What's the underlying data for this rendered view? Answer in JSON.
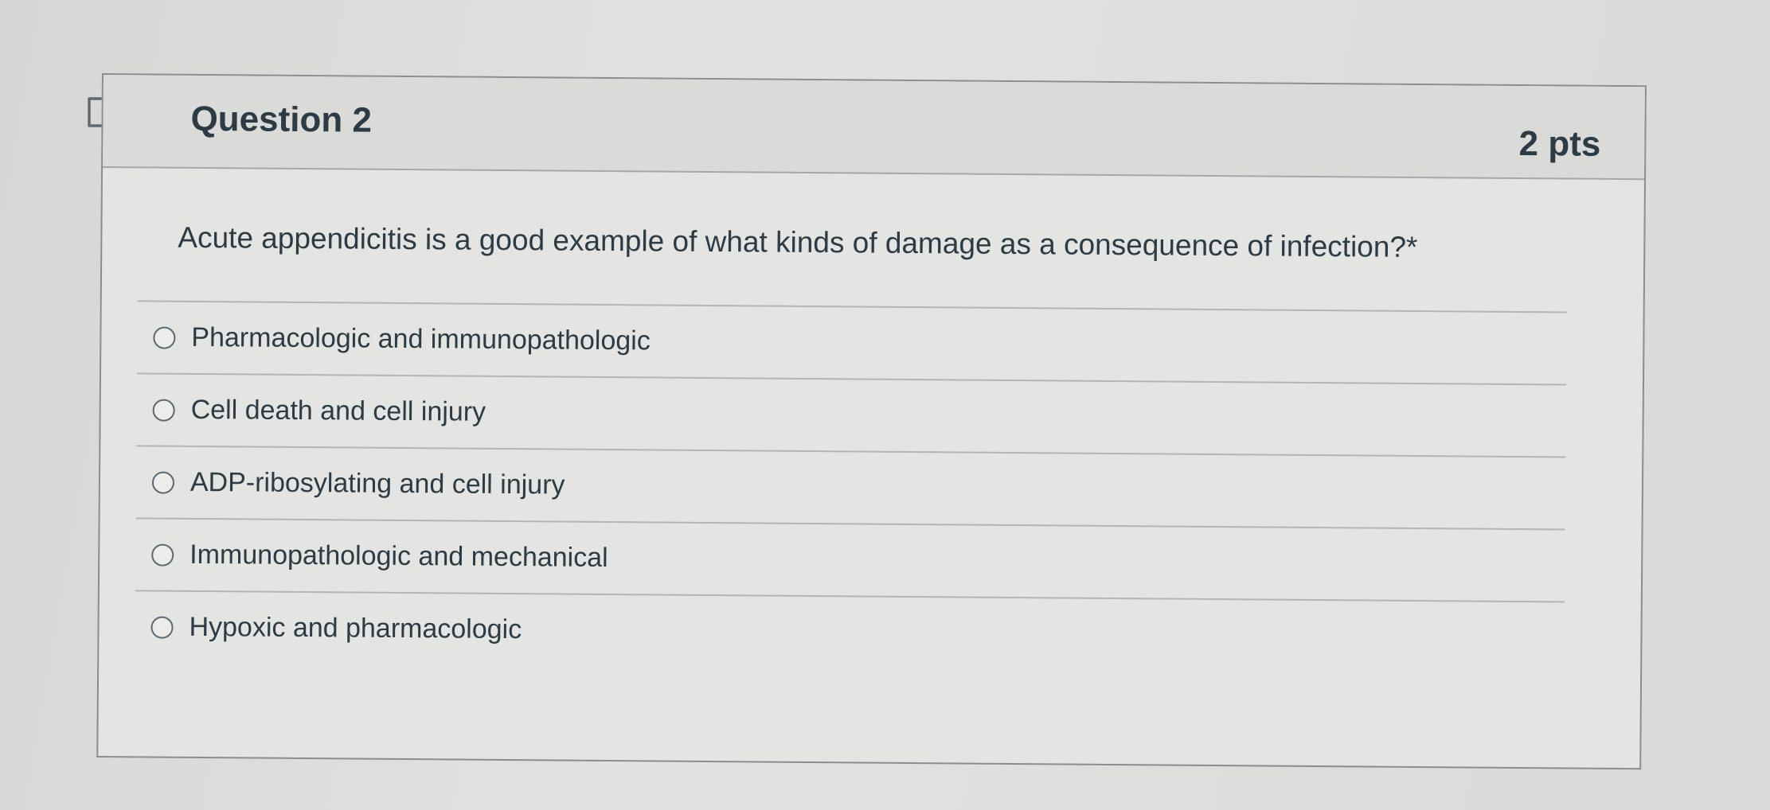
{
  "question": {
    "title": "Question 2",
    "points": "2 pts",
    "text": "Acute appendicitis is a good example of what kinds of damage as a consequence of infection?*"
  },
  "icons": {
    "flag": "flag-question-icon",
    "radio": "radio-unselected-icon"
  },
  "answers": [
    {
      "label": "Pharmacologic and immunopathologic"
    },
    {
      "label": "Cell death and cell injury"
    },
    {
      "label": "ADP-ribosylating and cell injury"
    },
    {
      "label": "Immunopathologic and mechanical"
    },
    {
      "label": "Hypoxic and pharmacologic"
    }
  ]
}
